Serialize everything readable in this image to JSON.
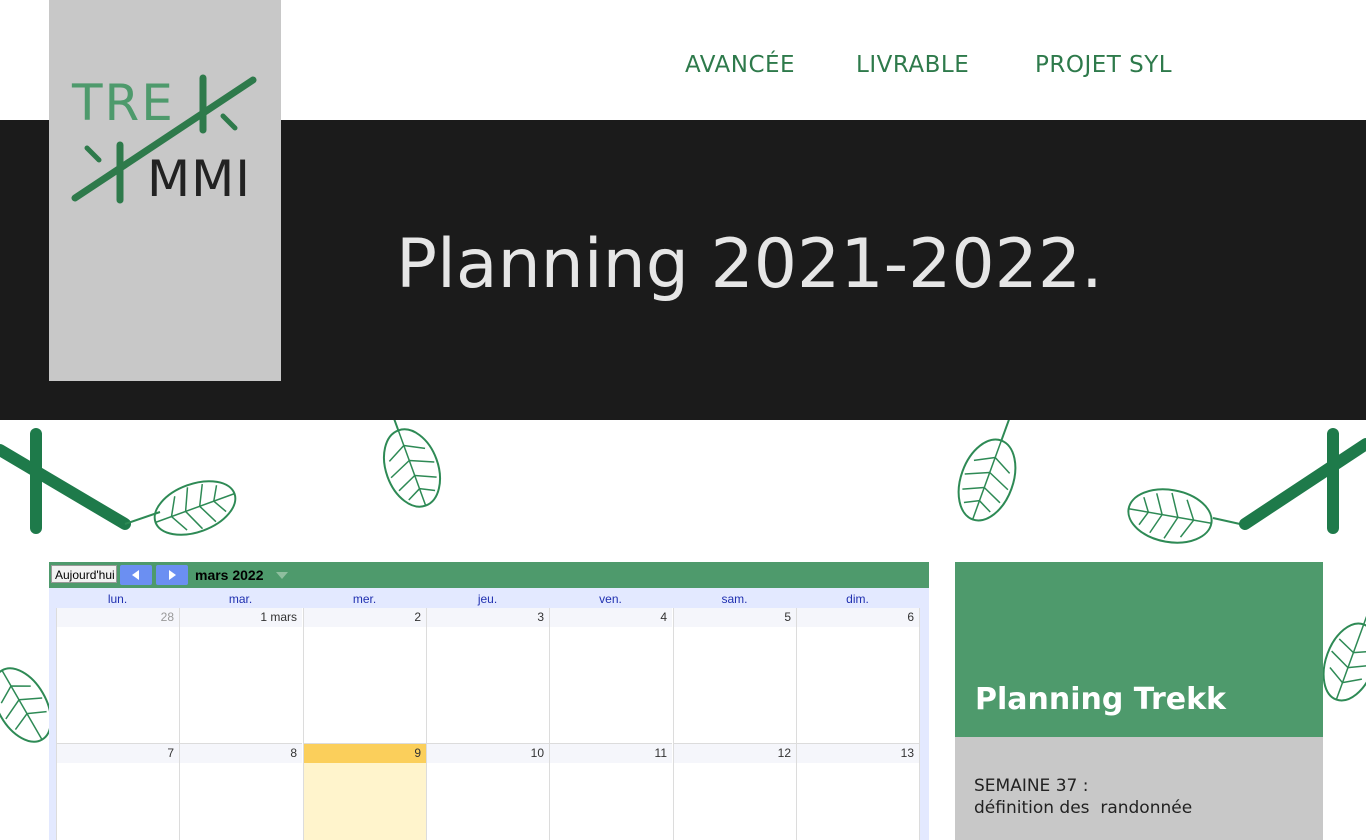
{
  "logo": {
    "line1": "TRE",
    "line2": "MMI",
    "brand_green": "#2e7a4b",
    "light_green": "#4e9a6c"
  },
  "nav": {
    "items": [
      {
        "label": "AVANCÉE"
      },
      {
        "label": "LIVRABLE"
      },
      {
        "label": "PROJET SYL"
      }
    ]
  },
  "hero": {
    "title": "Planning 2021-2022."
  },
  "calendar": {
    "today_button": "Aujourd'hui",
    "month": "mars 2022",
    "weekdays": [
      "lun.",
      "mar.",
      "mer.",
      "jeu.",
      "ven.",
      "sam.",
      "dim."
    ],
    "weeks": [
      [
        "28",
        "1 mars",
        "2",
        "3",
        "4",
        "5",
        "6"
      ],
      [
        "7",
        "8",
        "9",
        "10",
        "11",
        "12",
        "13"
      ]
    ],
    "today": "9",
    "toolbar_color": "#4e9a6c",
    "today_color": "#fbcf5b"
  },
  "side_panel": {
    "title": "Planning Trekk",
    "week_label": "SEMAINE 37 :",
    "week_desc": "définition des  randonnée"
  }
}
